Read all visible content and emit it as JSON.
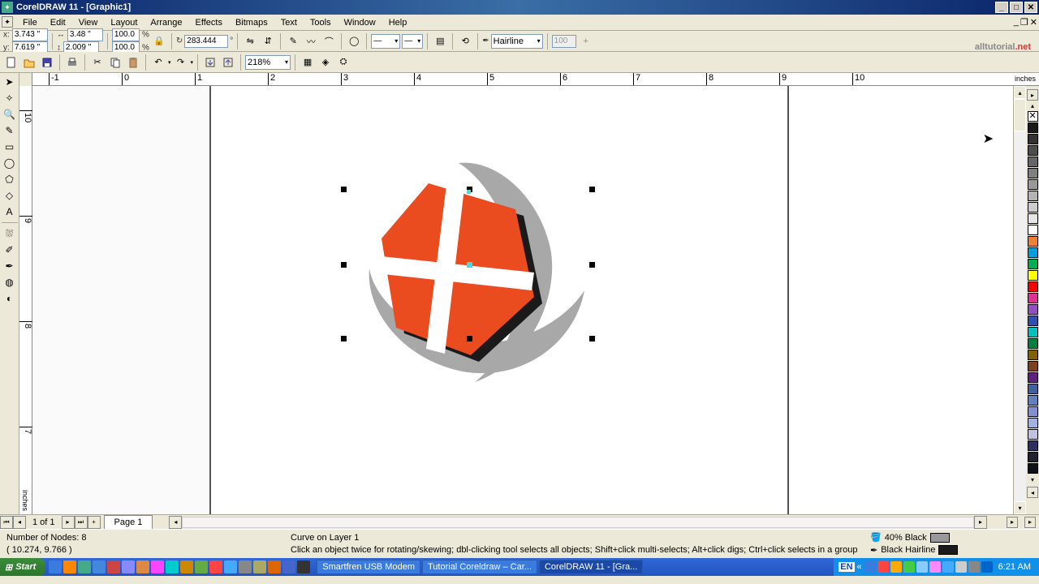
{
  "titlebar": {
    "title": "CorelDRAW 11 - [Graphic1]"
  },
  "menu": [
    "File",
    "Edit",
    "View",
    "Layout",
    "Arrange",
    "Effects",
    "Bitmaps",
    "Text",
    "Tools",
    "Window",
    "Help"
  ],
  "property_bar": {
    "x_label": "x:",
    "x": "3.743 \"",
    "y_label": "y:",
    "y": "7.619 \"",
    "w": "3.48 \"",
    "h": "2.009 \"",
    "scale_x": "100.0",
    "scale_y": "100.0",
    "scale_unit": "%",
    "rotation": "283.444",
    "rotation_unit": "°",
    "outline_width": "Hairline",
    "disabled_value": "100"
  },
  "standard_bar": {
    "zoom": "218%"
  },
  "watermark": {
    "a": "alltutorial",
    "b": ".net"
  },
  "rulers": {
    "h_ticks": [
      "-1",
      "0",
      "1",
      "2",
      "3",
      "4",
      "5",
      "6",
      "7",
      "8",
      "9",
      "10"
    ],
    "h_unit": "inches",
    "v_ticks": [
      "10",
      "9",
      "8",
      "7"
    ],
    "v_unit": "inches"
  },
  "page_nav": {
    "current": "1 of 1",
    "tab": "Page 1"
  },
  "status": {
    "nodes": "Number of Nodes: 8",
    "object": "Curve on Layer 1",
    "fill_label": "40% Black",
    "outline_label": "Black  Hairline",
    "coords": "( 10.274, 9.766 )",
    "hint": "Click an object twice for rotating/skewing; dbl-clicking tool selects all objects; Shift+click multi-selects; Alt+click digs; Ctrl+click selects in a group"
  },
  "color_palette": [
    "none",
    "#1a1a1a",
    "#333333",
    "#4d4d4d",
    "#666666",
    "#808080",
    "#999999",
    "#b3b3b3",
    "#cccccc",
    "#e6e6e6",
    "#ffffff",
    "#f08030",
    "#00a0e0",
    "#00b050",
    "#ffff00",
    "#ff0000",
    "#e03090",
    "#9050c0",
    "#3050b0",
    "#00c0c0",
    "#008040",
    "#806000",
    "#804020",
    "#602080",
    "#4060a0",
    "#6080c0",
    "#8090d0",
    "#a0b0e0",
    "#c0c0e0",
    "#303060",
    "#202030",
    "#101018"
  ],
  "status_fill_color": "#999999",
  "status_outline_color": "#1a1a1a",
  "taskbar": {
    "start": "Start",
    "tasks": [
      {
        "label": "Smartfren USB Modem",
        "active": false
      },
      {
        "label": "Tutorial Coreldraw – Car...",
        "active": false
      },
      {
        "label": "CorelDRAW 11 - [Gra...",
        "active": true
      }
    ],
    "lang": "EN",
    "clock": "6:21 AM"
  },
  "quick_launch_colors": [
    "#3a7be0",
    "#f80",
    "#4a8",
    "#48d",
    "#c44",
    "#88f",
    "#d84",
    "#f4f",
    "#0cc",
    "#c80",
    "#6a4",
    "#f44",
    "#4af",
    "#888",
    "#aa6",
    "#d60",
    "#46c",
    "#333"
  ],
  "tray_colors": [
    "#3a7be0",
    "#f44",
    "#fa0",
    "#4c4",
    "#8cf",
    "#f8f",
    "#4af",
    "#ccc",
    "#888",
    "#06c"
  ]
}
